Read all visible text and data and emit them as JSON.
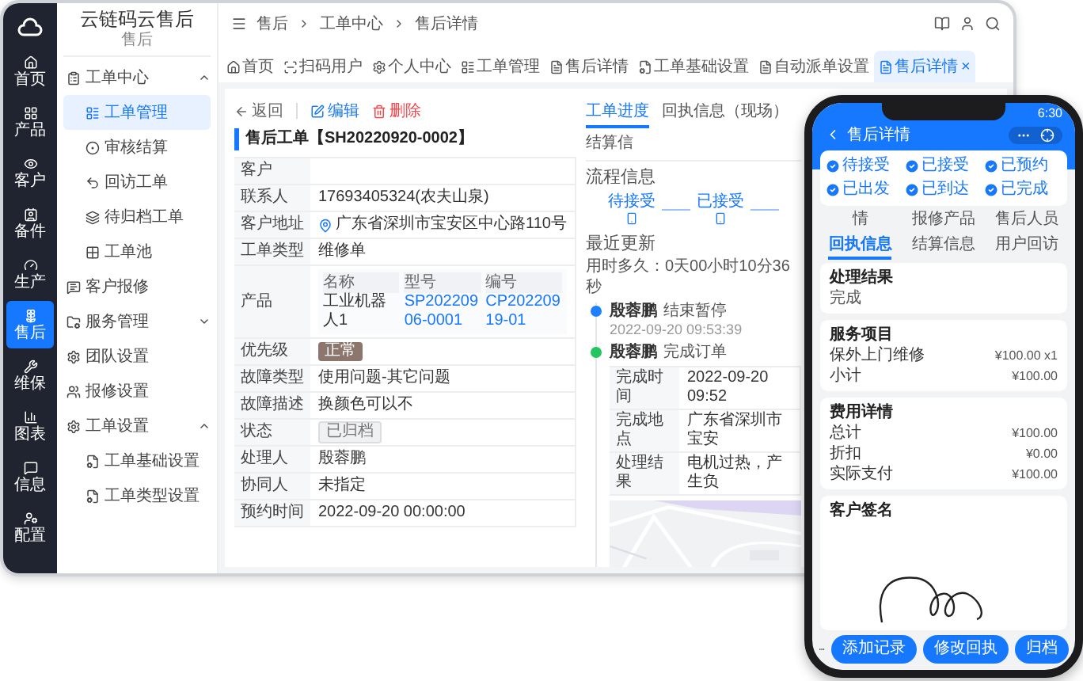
{
  "app_rail": {
    "items": [
      {
        "label": "首页",
        "selected": false
      },
      {
        "label": "产品",
        "selected": false
      },
      {
        "label": "客户",
        "selected": false
      },
      {
        "label": "备件",
        "selected": false
      },
      {
        "label": "生产",
        "selected": false
      },
      {
        "label": "售后",
        "selected": true
      },
      {
        "label": "维保",
        "selected": false
      },
      {
        "label": "图表",
        "selected": false
      },
      {
        "label": "信息",
        "selected": false
      },
      {
        "label": "配置",
        "selected": false
      }
    ]
  },
  "sidebar": {
    "title": "云链码云售后",
    "subtitle": "售后",
    "items": [
      {
        "kind": "group",
        "label": "工单中心",
        "expanded": true,
        "children": [
          {
            "label": "工单管理",
            "selected": true
          },
          {
            "label": "审核结算",
            "selected": false
          },
          {
            "label": "回访工单",
            "selected": false
          },
          {
            "label": "待归档工单",
            "selected": false
          },
          {
            "label": "工单池",
            "selected": false
          }
        ]
      },
      {
        "kind": "link",
        "label": "客户报修",
        "selected": false
      },
      {
        "kind": "group",
        "label": "服务管理",
        "expanded": false
      },
      {
        "kind": "link",
        "label": "团队设置",
        "selected": false
      },
      {
        "kind": "link",
        "label": "报修设置",
        "selected": false
      },
      {
        "kind": "group",
        "label": "工单设置",
        "expanded": true,
        "children": [
          {
            "label": "工单基础设置",
            "selected": false
          },
          {
            "label": "工单类型设置",
            "selected": false
          }
        ]
      }
    ]
  },
  "breadcrumb": [
    "售后",
    "工单中心",
    "售后详情"
  ],
  "tabs": [
    {
      "label": "首页",
      "selected": false
    },
    {
      "label": "扫码用户",
      "selected": false
    },
    {
      "label": "个人中心",
      "selected": false
    },
    {
      "label": "工单管理",
      "selected": false
    },
    {
      "label": "售后详情",
      "selected": false
    },
    {
      "label": "工单基础设置",
      "selected": false
    },
    {
      "label": "自动派单设置",
      "selected": false
    },
    {
      "label": "售后详情",
      "selected": true,
      "close": "×"
    }
  ],
  "toolbar": {
    "back": "返回",
    "edit": "编辑",
    "delete": "删除"
  },
  "order": {
    "title": "售后工单【SH20220920-0002】",
    "fields": [
      {
        "kind": "text",
        "label": "客户"
      },
      {
        "kind": "text",
        "label": "联系人",
        "value": "17693405324(农夫山泉)"
      },
      {
        "kind": "address",
        "label": "客户地址",
        "value": "广东省深圳市宝安区中心路110号"
      },
      {
        "kind": "text",
        "label": "工单类型",
        "value": "维修单"
      },
      {
        "kind": "products",
        "label": "产品",
        "columns": [
          "名称",
          "型号",
          "编号"
        ],
        "rows": [
          [
            "工业机器人1",
            "SP20220906-0001",
            "CP20220919-01"
          ]
        ]
      },
      {
        "kind": "tag",
        "label": "优先级",
        "value": "正常",
        "color": "#8d766e"
      },
      {
        "kind": "text",
        "label": "故障类型",
        "value": "使用问题-其它问题"
      },
      {
        "kind": "text",
        "label": "故障描述",
        "value": "换颜色可以不"
      },
      {
        "kind": "tag",
        "label": "状态",
        "value": "已归档",
        "color": "#f0f1f3"
      },
      {
        "kind": "text",
        "label": "处理人",
        "value": "殷蓉鹏"
      },
      {
        "kind": "text",
        "label": "协同人",
        "value": "未指定"
      },
      {
        "kind": "text",
        "label": "预约时间",
        "value": "2022-09-20 00:00:00"
      }
    ]
  },
  "progress": {
    "tabs": [
      {
        "label": "工单进度",
        "selected": true
      },
      {
        "label": "回执信息（现场）",
        "selected": false
      },
      {
        "label": "结算信",
        "selected": false
      }
    ],
    "flow_title": "流程信息",
    "steps": [
      "待接受",
      "已接受"
    ],
    "recent_title": "最近更新",
    "elapsed": "用时多久：0天00小时10分36秒",
    "events": [
      {
        "user": "殷蓉鹏",
        "action": "结束暂停",
        "time": "2022-09-20 09:53:39",
        "color": "#1e7fff"
      },
      {
        "user": "殷蓉鹏",
        "action": "完成订单",
        "color": "#22c55e",
        "details": [
          {
            "label": "完成时间",
            "value": "2022-09-20 09:52"
          },
          {
            "label": "完成地点",
            "value": "广东省深圳市宝安"
          },
          {
            "label": "处理结果",
            "value": "电机过热，产生负"
          }
        ]
      }
    ]
  },
  "phone": {
    "time": "6:30",
    "title": "售后详情",
    "steps": [
      {
        "label": "待接受",
        "done": true
      },
      {
        "label": "已接受",
        "done": true
      },
      {
        "label": "已预约",
        "done": true
      },
      {
        "label": "已出发",
        "done": true
      },
      {
        "label": "已到达",
        "done": true
      },
      {
        "label": "已完成",
        "done": true
      }
    ],
    "tabs": [
      {
        "label": "情",
        "selected": false
      },
      {
        "label": "报修产品",
        "selected": false
      },
      {
        "label": "售后人员",
        "selected": false
      },
      {
        "label": "回执信息",
        "selected": true
      },
      {
        "label": "结算信息",
        "selected": false
      },
      {
        "label": "用户回访",
        "selected": false
      }
    ],
    "cards": [
      {
        "kind": "result",
        "title": "处理结果",
        "value": "完成"
      },
      {
        "kind": "lines",
        "title": "服务项目",
        "lines": [
          {
            "label": "保外上门维修",
            "value": "¥100.00 x1"
          },
          {
            "label": "小计",
            "value": "¥100.00"
          }
        ]
      },
      {
        "kind": "lines",
        "title": "费用详情",
        "lines": [
          {
            "label": "总计",
            "value": "¥100.00"
          },
          {
            "label": "折扣",
            "value": "¥0.00"
          },
          {
            "label": "实际支付",
            "value": "¥100.00"
          }
        ]
      },
      {
        "kind": "signature",
        "title": "客户签名"
      }
    ],
    "buttons": [
      "添加记录",
      "修改回执",
      "归档"
    ]
  }
}
